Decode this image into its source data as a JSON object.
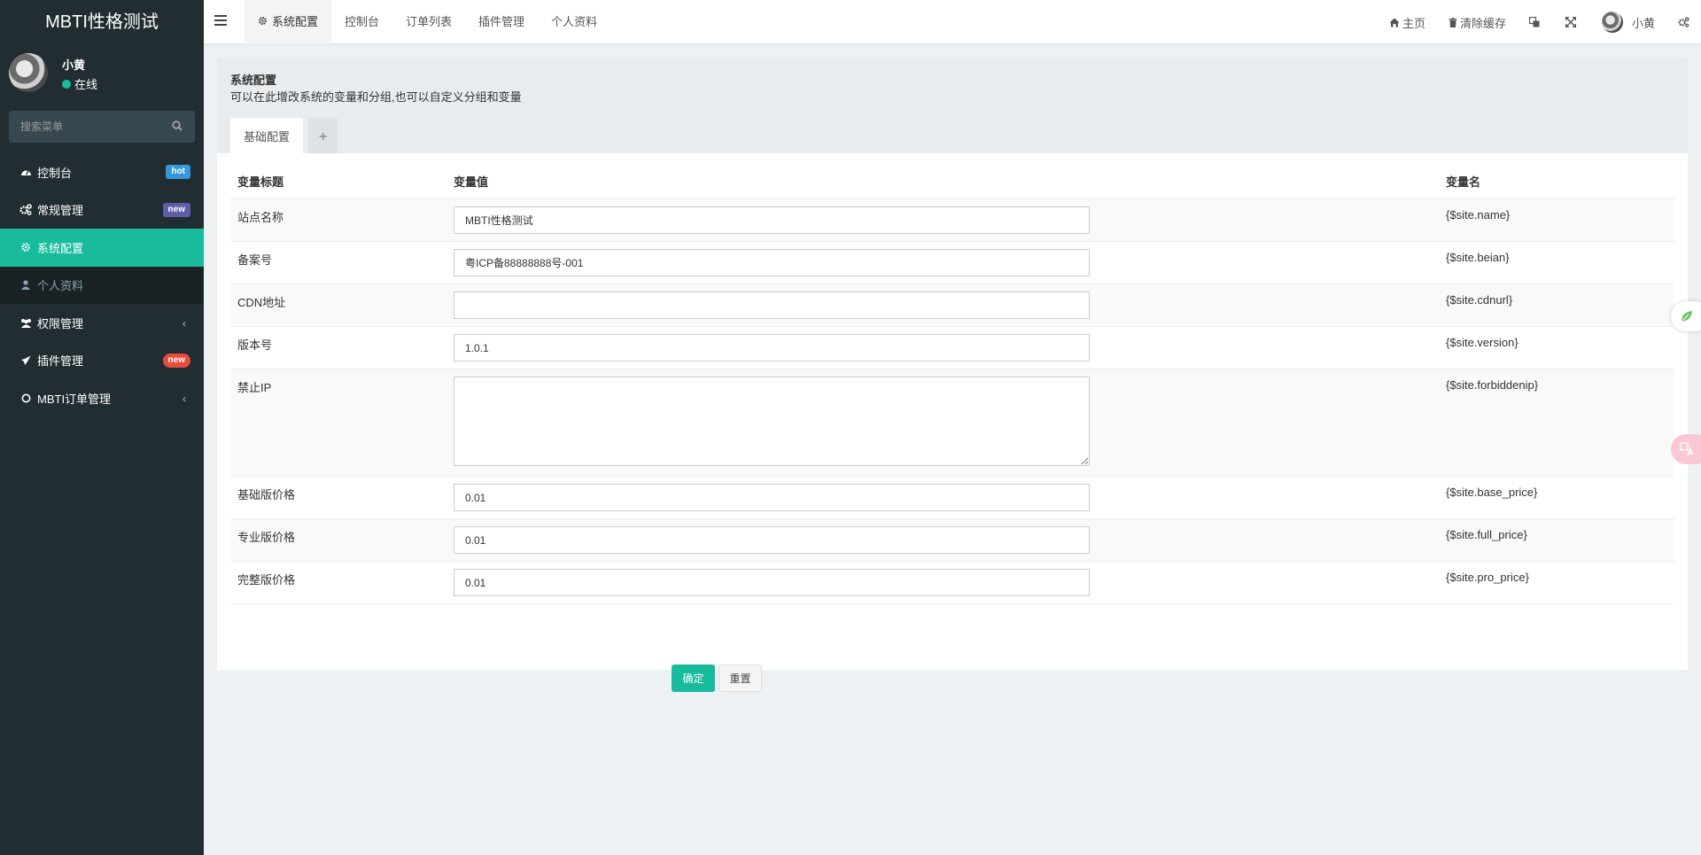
{
  "app": {
    "logo": "MBTI性格测试"
  },
  "user": {
    "name": "小黄",
    "status": "在线"
  },
  "search": {
    "placeholder": "搜索菜单"
  },
  "sidebar": {
    "items": [
      {
        "label": "控制台",
        "badge": "hot",
        "icon": "dashboard-icon"
      },
      {
        "label": "常规管理",
        "badge": "new",
        "icon": "cogs-icon"
      },
      {
        "label": "系统配置",
        "icon": "gear-icon",
        "active": true
      },
      {
        "label": "个人资料",
        "icon": "user-icon",
        "sub": true
      },
      {
        "label": "权限管理",
        "icon": "group-icon",
        "chevron": "‹"
      },
      {
        "label": "插件管理",
        "badge": "new",
        "icon": "rocket-icon"
      },
      {
        "label": "MBTI订单管理",
        "icon": "circle-icon",
        "chevron": "‹"
      }
    ]
  },
  "header": {
    "tabs": [
      {
        "label": "系统配置",
        "active": true
      },
      {
        "label": "控制台"
      },
      {
        "label": "订单列表"
      },
      {
        "label": "插件管理"
      },
      {
        "label": "个人资料"
      }
    ],
    "right": {
      "home": "主页",
      "clear_cache": "清除缓存",
      "username": "小黄"
    }
  },
  "panel": {
    "title": "系统配置",
    "description": "可以在此增改系统的变量和分组,也可以自定义分组和变量",
    "tabs": [
      {
        "label": "基础配置"
      }
    ],
    "add_tab": "+"
  },
  "table": {
    "headers": {
      "title": "变量标题",
      "value": "变量值",
      "name": "变量名"
    },
    "rows": [
      {
        "title": "站点名称",
        "value": "MBTI性格测试",
        "name": "{$site.name}"
      },
      {
        "title": "备案号",
        "value": "粤ICP备88888888号-001",
        "name": "{$site.beian}"
      },
      {
        "title": "CDN地址",
        "value": "",
        "name": "{$site.cdnurl}"
      },
      {
        "title": "版本号",
        "value": "1.0.1",
        "name": "{$site.version}"
      },
      {
        "title": "禁止IP",
        "value": "",
        "name": "{$site.forbiddenip}"
      },
      {
        "title": "基础版价格",
        "value": "0.01",
        "name": "{$site.base_price}"
      },
      {
        "title": "专业版价格",
        "value": "0.01",
        "name": "{$site.full_price}"
      },
      {
        "title": "完整版价格",
        "value": "0.01",
        "name": "{$site.pro_price}"
      }
    ]
  },
  "buttons": {
    "ok": "确定",
    "reset": "重置"
  },
  "colors": {
    "accent": "#18bc9c",
    "sidebar_bg": "#222d32"
  }
}
